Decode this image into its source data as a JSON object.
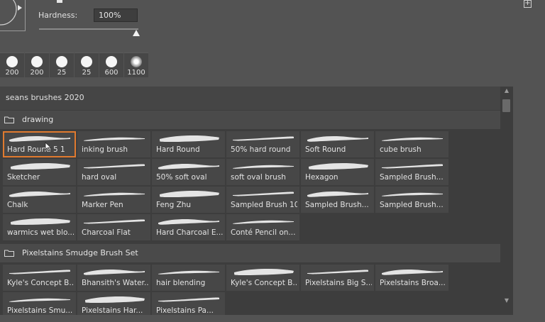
{
  "settings": {
    "hardness_label": "Hardness:",
    "hardness_value": "100%",
    "hardness_percent": 100
  },
  "recent_brushes": [
    {
      "size": "200",
      "icon": "hard-round"
    },
    {
      "size": "200",
      "icon": "hard-round"
    },
    {
      "size": "25",
      "icon": "hard-round"
    },
    {
      "size": "25",
      "icon": "hard-round"
    },
    {
      "size": "600",
      "icon": "hard-round"
    },
    {
      "size": "1100",
      "icon": "soft-round"
    }
  ],
  "brush_set": {
    "title": "seans brushes 2020"
  },
  "groups": [
    {
      "name": "drawing",
      "brushes": [
        "Hard Round 5 1",
        "inking brush",
        "Hard Round",
        "50% hard round",
        "Soft Round",
        "cube brush",
        "Sketcher",
        "hard oval",
        "50% soft oval",
        "soft oval brush",
        "Hexagon",
        "Sampled Brush...",
        "Chalk",
        "Marker Pen",
        "Feng Zhu",
        "Sampled Brush 10",
        "Sampled Brush...",
        "Sampled Brush...",
        "warmics wet blo...",
        "Charcoal Flat",
        "Hard Charcoal E...",
        "Conté Pencil on..."
      ]
    },
    {
      "name": "Pixelstains Smudge Brush Set",
      "brushes": [
        "Kyle's Concept B...",
        "Bhansith's Water...",
        "hair blending",
        "Kyle's Concept B...",
        "Pixelstains Big S...",
        "Pixelstains Broa...",
        "Pixelstains Smu...",
        "Pixelstains Har...",
        "Pixelstains Pa..."
      ]
    }
  ],
  "selected_brush": "Hard Round 5 1",
  "colors": {
    "selection": "#e07a2f",
    "panel": "#3d3d3d",
    "background": "#535353"
  },
  "icons": [
    "folder-icon",
    "new-brush-icon",
    "cursor-icon"
  ]
}
